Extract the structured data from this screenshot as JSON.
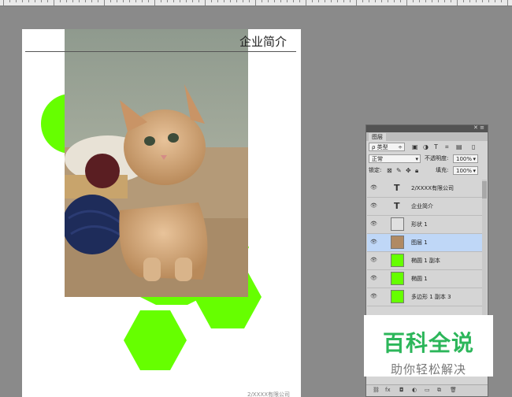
{
  "document": {
    "title": "企业简介",
    "footer": "2/XXXX有限公司"
  },
  "layers_panel": {
    "tab_label": "图层",
    "filter_kind": "ρ 类型",
    "blend_mode": "正常",
    "opacity_label": "不透明度:",
    "opacity_value": "100%",
    "lock_label": "锁定:",
    "fill_label": "填充:",
    "fill_value": "100%",
    "layers": [
      {
        "name": "2/XXXX有限公司",
        "kind": "text",
        "selected": false
      },
      {
        "name": "企业简介",
        "kind": "text",
        "selected": false
      },
      {
        "name": "形状 1",
        "kind": "shape",
        "selected": false
      },
      {
        "name": "图层 1",
        "kind": "image",
        "selected": true
      },
      {
        "name": "椭圆 1 副本",
        "kind": "shape-green",
        "selected": false
      },
      {
        "name": "椭圆 1",
        "kind": "shape-green",
        "selected": false
      },
      {
        "name": "多边形 1 副本 3",
        "kind": "shape-green",
        "selected": false
      }
    ]
  },
  "watermark": {
    "title": "百科全说",
    "subtitle": "助你轻松解决"
  },
  "colors": {
    "canvas_bg": "#8a8a8a",
    "shape_green": "#66ff00",
    "selected_layer": "#bfd7f7",
    "watermark_green": "#2cb65a"
  }
}
